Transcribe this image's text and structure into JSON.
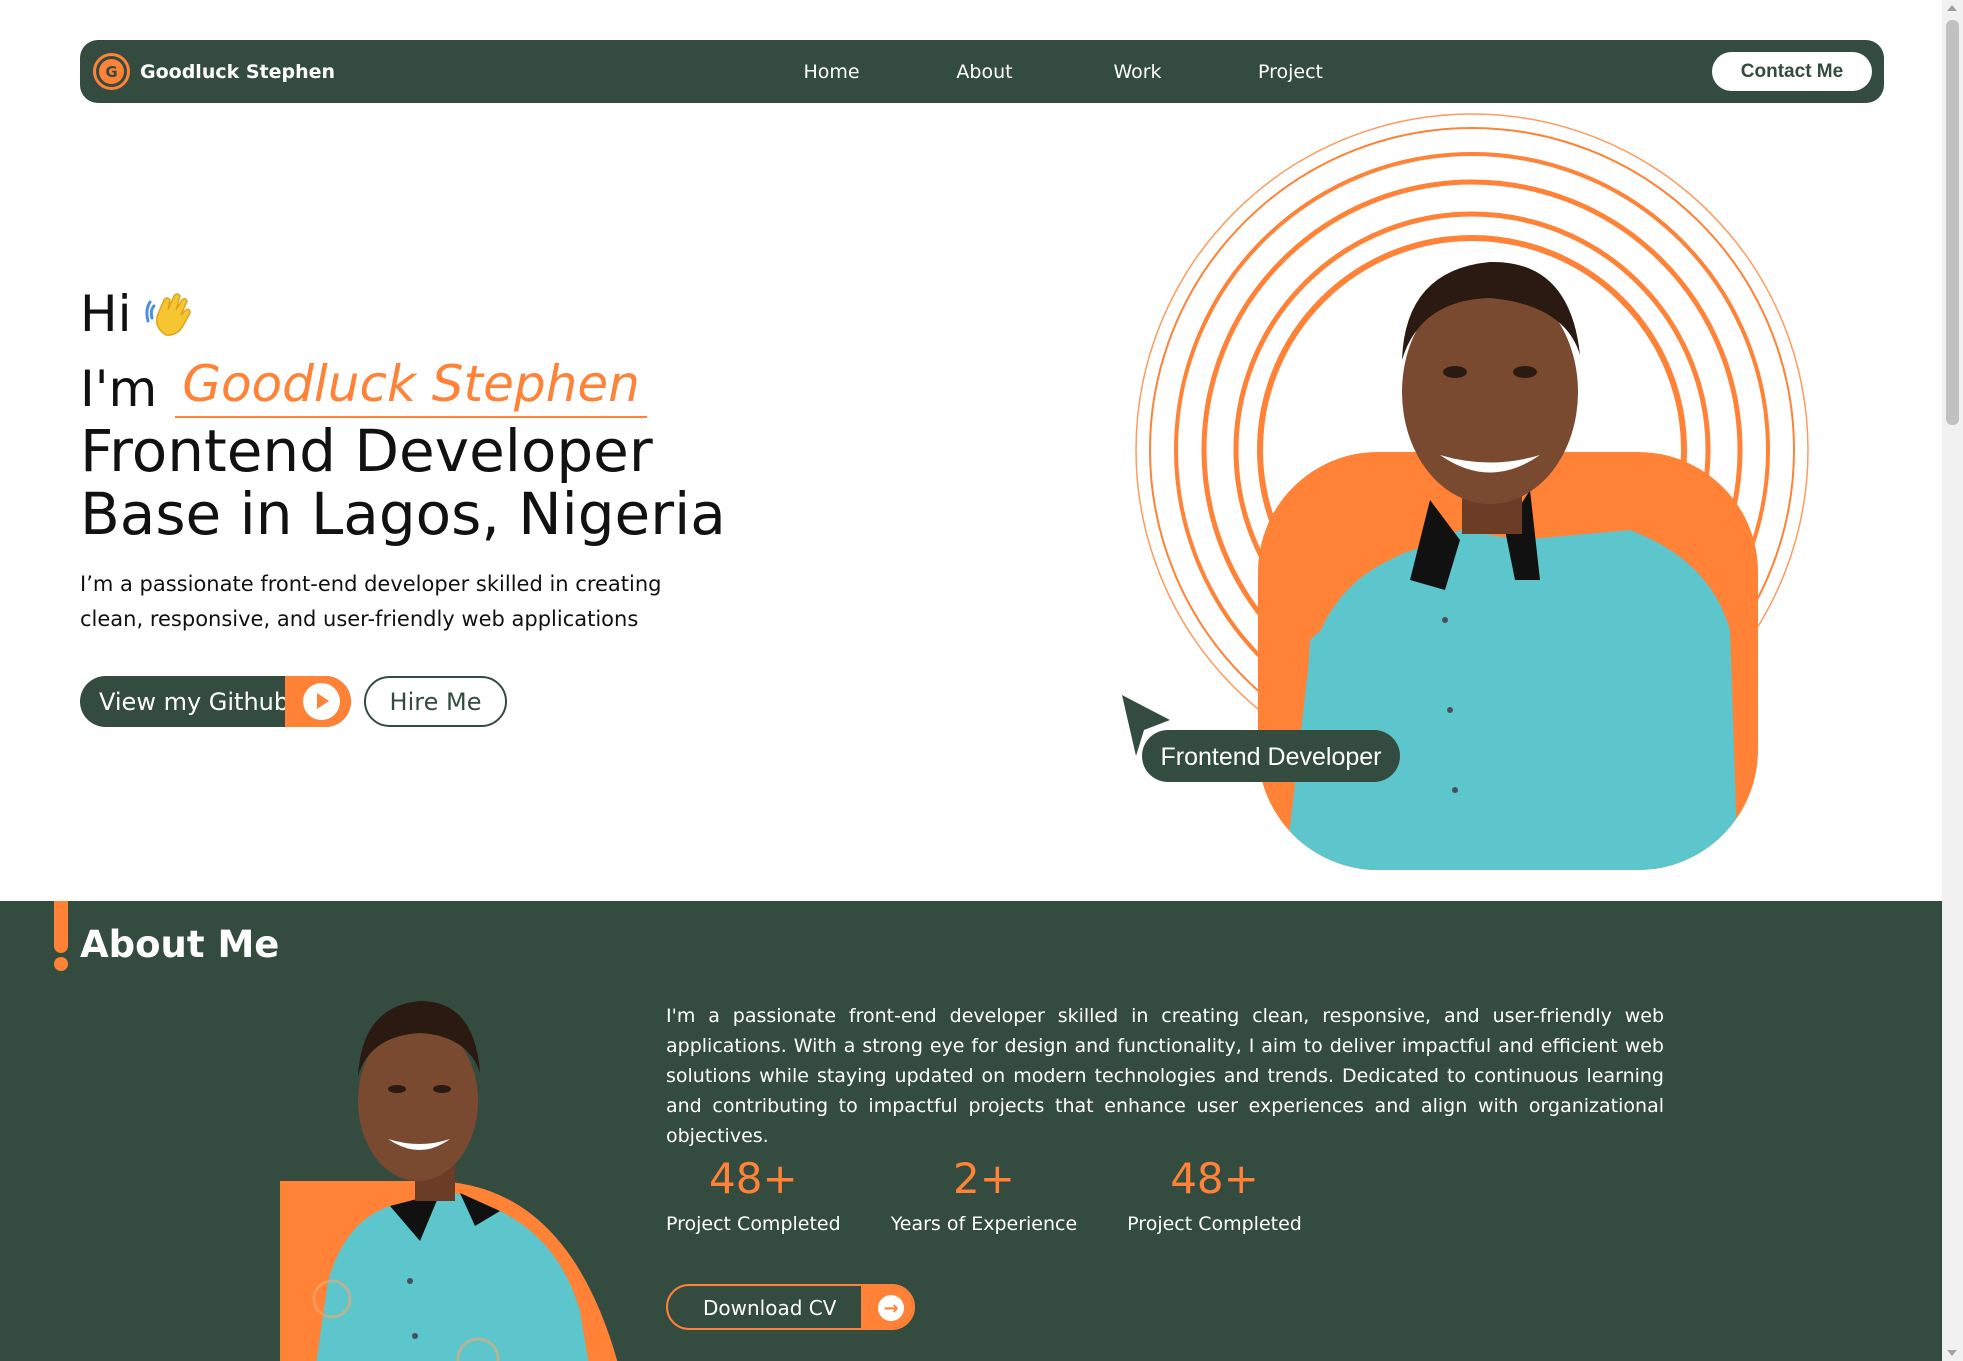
{
  "colors": {
    "accent": "#ff8237",
    "brand_dark": "#344c40",
    "shirt": "#5cc6cc"
  },
  "nav": {
    "logo_letter": "G",
    "brand": "Goodluck Stephen",
    "links": [
      "Home",
      "About",
      "Work",
      "Project"
    ],
    "contact_label": "Contact Me"
  },
  "hero": {
    "greeting": "Hi",
    "greeting_icon": "waving-hand-icon",
    "im": "I'm",
    "name": "Goodluck Stephen",
    "role_line1": "Frontend Developer",
    "role_line2": "Base in Lagos, Nigeria",
    "description": "I’m a passionate front-end developer skilled in creating clean, responsive, and user-friendly web applications",
    "github_label": "View my Github",
    "hire_label": "Hire Me",
    "badge": "Frontend Developer"
  },
  "about": {
    "title": "About Me",
    "text": "I'm a passionate front-end developer skilled in creating clean, responsive, and user-friendly web applications. With a strong eye for design and functionality, I aim to deliver impactful and efficient web solutions while staying updated on modern technologies and trends. Dedicated to continuous learning and contributing to impactful projects that enhance user experiences and align with organizational objectives.",
    "stats": [
      {
        "value": "48+",
        "label": "Project Completed"
      },
      {
        "value": "2+",
        "label": "Years of Experience"
      },
      {
        "value": "48+",
        "label": "Project Completed"
      }
    ],
    "cv_label": "Download CV"
  }
}
